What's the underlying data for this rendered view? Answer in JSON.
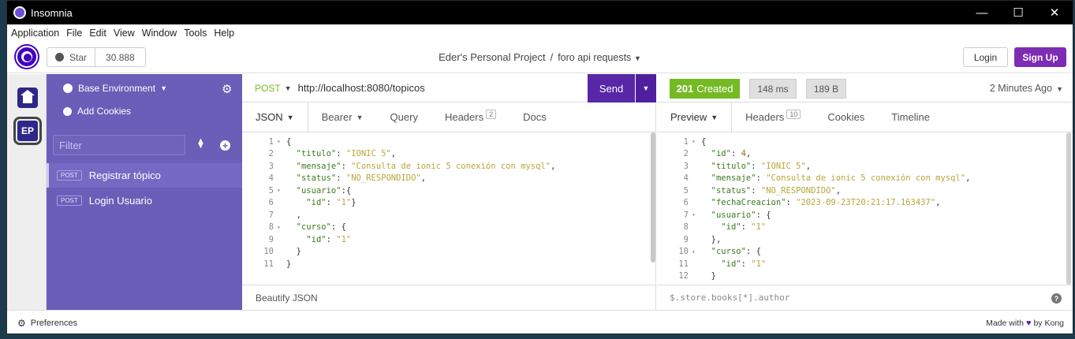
{
  "window": {
    "title": "Insomnia",
    "controls": [
      "—",
      "☐",
      "✕"
    ]
  },
  "menu": [
    "Application",
    "File",
    "Edit",
    "View",
    "Window",
    "Tools",
    "Help"
  ],
  "topbar": {
    "star_label": "Star",
    "star_count": "30.888",
    "project": "Eder's Personal Project",
    "separator": "/",
    "collection": "foro api requests",
    "login": "Login",
    "signup": "Sign Up"
  },
  "leftbar": {
    "workspace_initials": "EP"
  },
  "sidebar": {
    "environment": "Base Environment",
    "add_cookies": "Add Cookies",
    "filter_placeholder": "Filter",
    "requests": [
      {
        "method": "POST",
        "name": "Registrar tópico",
        "active": true
      },
      {
        "method": "POST",
        "name": "Login Usuario",
        "active": false
      }
    ]
  },
  "request": {
    "method": "POST",
    "url": "http://localhost:8080/topicos",
    "send": "Send",
    "tabs": [
      {
        "label": "JSON",
        "caret": true
      },
      {
        "label": "Bearer",
        "caret": true
      },
      {
        "label": "Query"
      },
      {
        "label": "Headers",
        "badge": "2"
      },
      {
        "label": "Docs"
      }
    ],
    "body_lines": [
      {
        "n": "1",
        "fold": true,
        "html": "{"
      },
      {
        "n": "2",
        "html": "  <span class='k'>\"titulo\"</span>: <span class='s'>\"IONIC 5\"</span>,"
      },
      {
        "n": "3",
        "html": "  <span class='k'>\"mensaje\"</span>: <span class='s'>\"Consulta de ionic 5 conexión con mysql\"</span>,"
      },
      {
        "n": "4",
        "html": "  <span class='k'>\"status\"</span>: <span class='s'>\"NO_RESPONDIDO\"</span>,"
      },
      {
        "n": "5",
        "fold": true,
        "html": "  <span class='k'>\"usuario\"</span>:{"
      },
      {
        "n": "6",
        "html": "    <span class='k'>\"id\"</span>: <span class='s'>\"1\"</span>}"
      },
      {
        "n": "7",
        "html": "  ,"
      },
      {
        "n": "8",
        "fold": true,
        "html": "  <span class='k'>\"curso\"</span>: {"
      },
      {
        "n": "9",
        "html": "    <span class='k'>\"id\"</span>: <span class='s'>\"1\"</span>"
      },
      {
        "n": "10",
        "html": "  }"
      },
      {
        "n": "11",
        "html": "}"
      }
    ],
    "beautify": "Beautify JSON"
  },
  "response": {
    "status_code": "201",
    "status_text": "Created",
    "time": "148 ms",
    "size": "189 B",
    "ago": "2 Minutes Ago",
    "tabs": [
      {
        "label": "Preview",
        "caret": true
      },
      {
        "label": "Headers",
        "badge": "10"
      },
      {
        "label": "Cookies"
      },
      {
        "label": "Timeline"
      }
    ],
    "body_lines": [
      {
        "n": "1",
        "fold": true,
        "html": "{"
      },
      {
        "n": "2",
        "html": "  <span class='k'>\"id\"</span>: <span class='n'>4</span>,"
      },
      {
        "n": "3",
        "html": "  <span class='k'>\"titulo\"</span>: <span class='s'>\"IONIC 5\"</span>,"
      },
      {
        "n": "4",
        "html": "  <span class='k'>\"mensaje\"</span>: <span class='s'>\"Consulta de ionic 5 conexión con mysql\"</span>,"
      },
      {
        "n": "5",
        "html": "  <span class='k'>\"status\"</span>: <span class='s'>\"NO_RESPONDIDO\"</span>,"
      },
      {
        "n": "6",
        "html": "  <span class='k'>\"fechaCreacion\"</span>: <span class='s'>\"2023-09-23T20:21:17.163437\"</span>,"
      },
      {
        "n": "7",
        "fold": true,
        "html": "  <span class='k'>\"usuario\"</span>: {"
      },
      {
        "n": "8",
        "html": "    <span class='k'>\"id\"</span>: <span class='s'>\"1\"</span>"
      },
      {
        "n": "9",
        "html": "  },"
      },
      {
        "n": "10",
        "fold": true,
        "html": "  <span class='k'>\"curso\"</span>: {"
      },
      {
        "n": "11",
        "html": "    <span class='k'>\"id\"</span>: <span class='s'>\"1\"</span>"
      },
      {
        "n": "12",
        "html": "  }"
      }
    ],
    "filter_placeholder": "$.store.books[*].author"
  },
  "footer": {
    "preferences": "Preferences",
    "made_with": "Made with",
    "by": "by Kong"
  },
  "colors": {
    "accent": "#5727a6",
    "success": "#75ba24",
    "sidebar": "#695eb8",
    "brand": "#4000bf"
  }
}
